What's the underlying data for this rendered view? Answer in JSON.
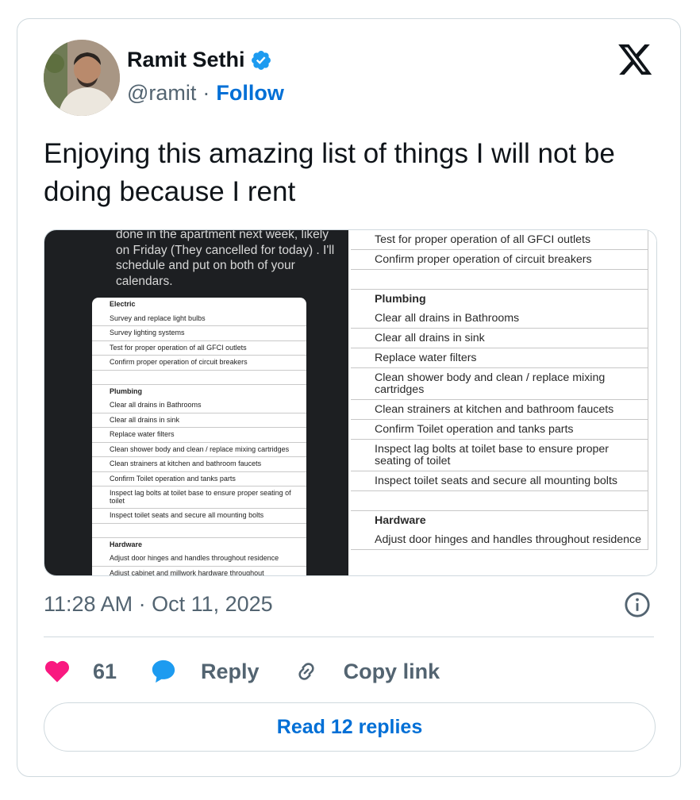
{
  "author": {
    "name": "Ramit Sethi",
    "handle": "@ramit",
    "separator": "·",
    "follow_label": "Follow",
    "verified_color": "#1d9bf0"
  },
  "tweet": {
    "text": "Enjoying this amazing list of things I will not be doing because I rent",
    "timestamp": "11:28 AM · Oct 11, 2025"
  },
  "media": {
    "left": {
      "message": "done in the apartment next week, likely on Friday (They cancelled for today) .  I'll schedule and put on both of your calendars.",
      "rows": [
        {
          "text": "Electric",
          "header": true
        },
        {
          "text": "Survey and replace light bulbs"
        },
        {
          "text": "Survey lighting systems"
        },
        {
          "text": "Test for proper operation of all GFCI outlets"
        },
        {
          "text": "Confirm proper operation of circuit breakers"
        },
        {
          "text": ""
        },
        {
          "text": "Plumbing",
          "header": true
        },
        {
          "text": "Clear all drains in Bathrooms"
        },
        {
          "text": "Clear all drains in sink"
        },
        {
          "text": "Replace water filters"
        },
        {
          "text": "Clean shower body and clean / replace mixing cartridges"
        },
        {
          "text": "Clean strainers at kitchen and bathroom faucets"
        },
        {
          "text": "Confirm Toilet operation and tanks parts"
        },
        {
          "text": "Inspect lag bolts at toilet base to ensure proper seating of toilet"
        },
        {
          "text": "Inspect toilet seats and secure all mounting bolts"
        },
        {
          "text": ""
        },
        {
          "text": "Hardware",
          "header": true
        },
        {
          "text": "Adjust door hinges and handles throughout residence"
        },
        {
          "text": "Adjust cabinet and millwork hardware throughout"
        }
      ]
    },
    "right": {
      "rows": [
        {
          "text": "Test for proper operation of all GFCI outlets"
        },
        {
          "text": "Confirm proper operation of circuit breakers"
        },
        {
          "text": ""
        },
        {
          "text": "Plumbing",
          "header": true
        },
        {
          "text": "Clear all drains in Bathrooms"
        },
        {
          "text": "Clear all drains in sink"
        },
        {
          "text": "Replace water filters"
        },
        {
          "text": "Clean shower body and clean / replace mixing cartridges"
        },
        {
          "text": "Clean strainers at kitchen and bathroom faucets"
        },
        {
          "text": "Confirm Toilet operation and tanks parts"
        },
        {
          "text": "Inspect lag bolts at toilet base to ensure proper seating of toilet"
        },
        {
          "text": "Inspect toilet seats and secure all mounting bolts"
        },
        {
          "text": ""
        },
        {
          "text": "Hardware",
          "header": true
        },
        {
          "text": "Adjust door hinges and handles throughout residence"
        }
      ]
    }
  },
  "actions": {
    "like_count": "61",
    "reply_label": "Reply",
    "copy_link_label": "Copy link",
    "like_color": "#f91880",
    "reply_color": "#1d9bf0"
  },
  "read_replies_label": "Read 12 replies",
  "icons": {
    "brand": "x-logo-icon",
    "info": "info-icon",
    "like": "heart-icon",
    "reply": "speech-bubble-icon",
    "copy": "link-icon"
  }
}
